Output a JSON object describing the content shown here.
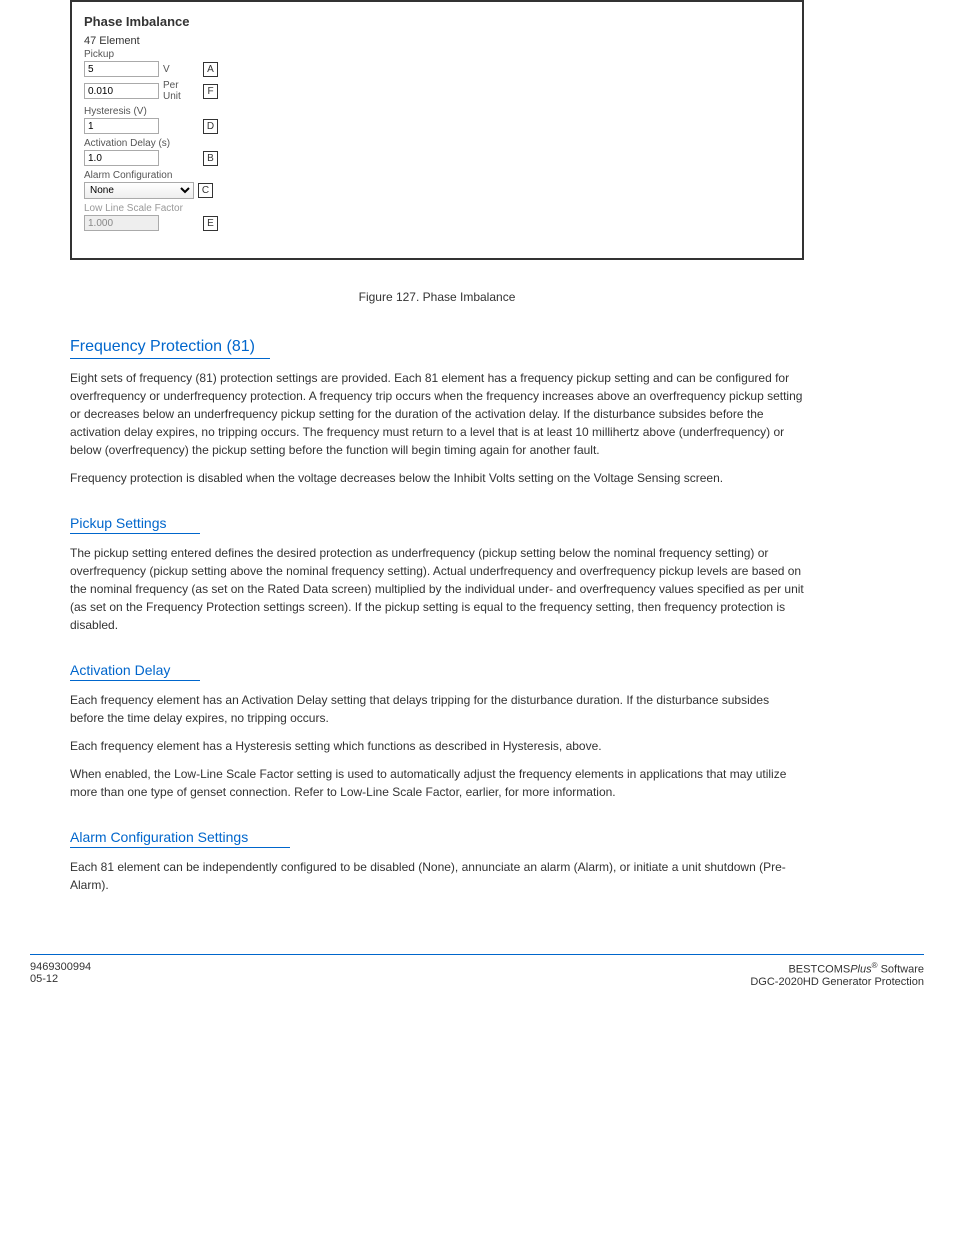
{
  "screenshot": {
    "title": "Phase Imbalance",
    "fieldsetLabel": "47 Element",
    "pickup": {
      "label": "Pickup",
      "valueV": "5",
      "unit1": "V",
      "letter1": "A",
      "valuePU": "0.010",
      "unit2": "Per Unit",
      "letter2": "F"
    },
    "hysteresis": {
      "label": "Hysteresis (V)",
      "value": "1",
      "letter": "D"
    },
    "activation": {
      "label": "Activation Delay (s)",
      "value": "1.0",
      "letter": "B"
    },
    "alarm": {
      "label": "Alarm Configuration",
      "value": "None",
      "letter": "C"
    },
    "lowline": {
      "label": "Low Line Scale Factor",
      "value": "1.000",
      "letter": "E"
    }
  },
  "figureCaption": "Figure 127. Phase Imbalance",
  "sections": {
    "freqHeading": "Frequency Protection (81)",
    "freqP1": "Eight sets of frequency (81) protection settings are provided. Each 81 element has a frequency pickup setting and can be configured for overfrequency or underfrequency protection. A frequency trip occurs when the frequency increases above an overfrequency pickup setting or decreases below an underfrequency pickup setting for the duration of the activation delay. If the disturbance subsides before the activation delay expires, no tripping occurs. The frequency must return to a level that is at least 10 millihertz above (underfrequency) or below (overfrequency) the pickup setting before the function will begin timing again for another fault.",
    "freqP2": "Frequency protection is disabled when the voltage decreases below the Inhibit Volts setting on the Voltage Sensing screen.",
    "pickupHeading": "Pickup Settings",
    "pickupP1": "The pickup setting entered defines the desired protection as underfrequency (pickup setting below the nominal frequency setting) or overfrequency (pickup setting above the nominal frequency setting). Actual underfrequency and overfrequency pickup levels are based on the nominal frequency (as set on the Rated Data screen) multiplied by the individual under- and overfrequency values specified as per unit (as set on the Frequency Protection settings screen). If the pickup setting is equal to the frequency setting, then frequency protection is disabled.",
    "actDelayHeading": "Activation Delay",
    "actDelayP1": "Each frequency element has an Activation Delay setting that delays tripping for the disturbance duration. If the disturbance subsides before the time delay expires, no tripping occurs.",
    "actDelayP2": "Each frequency element has a Hysteresis setting which functions as described in Hysteresis, above.",
    "actDelayP3": "When enabled, the Low-Line Scale Factor setting is used to automatically adjust the frequency elements in applications that may utilize more than one type of genset connection. Refer to Low-Line Scale Factor, earlier, for more information.",
    "alarmHeading": "Alarm Configuration Settings",
    "alarmP1": "Each 81 element can be independently configured to be disabled (None), annunciate an alarm (Alarm), or initiate a unit shutdown (Pre-Alarm)."
  },
  "footer": {
    "leftLine1": "9469300994",
    "leftLine2": "05-12",
    "right": "DGC-2020HD Generator Protection",
    "reg": "®"
  }
}
